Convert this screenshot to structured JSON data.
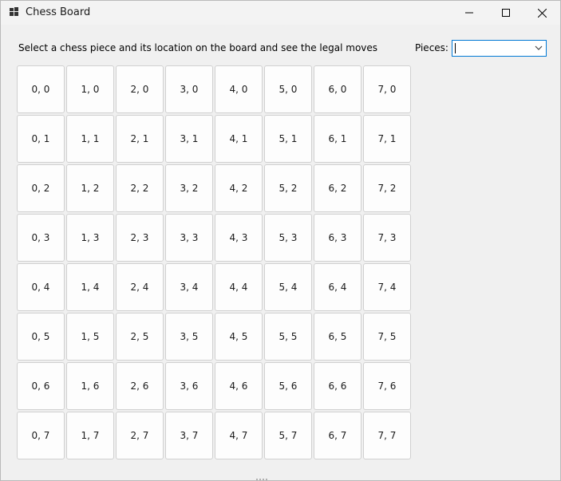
{
  "window": {
    "title": "Chess Board",
    "icon": "window-app-icon",
    "controls": {
      "minimize_icon": "minimize-icon",
      "maximize_icon": "maximize-icon",
      "close_icon": "close-icon"
    }
  },
  "main": {
    "prompt": "Select a chess piece and its location on the board and see the legal moves",
    "pieces_label": "Pieces:",
    "pieces_value": "",
    "pieces_dropdown_icon": "chevron-down-icon"
  },
  "board": {
    "rows": [
      [
        "0, 0",
        "1, 0",
        "2, 0",
        "3, 0",
        "4, 0",
        "5, 0",
        "6, 0",
        "7, 0"
      ],
      [
        "0, 1",
        "1, 1",
        "2, 1",
        "3, 1",
        "4, 1",
        "5, 1",
        "6, 1",
        "7, 1"
      ],
      [
        "0, 2",
        "1, 2",
        "2, 2",
        "3, 2",
        "4, 2",
        "5, 2",
        "6, 2",
        "7, 2"
      ],
      [
        "0, 3",
        "1, 3",
        "2, 3",
        "3, 3",
        "4, 3",
        "5, 3",
        "6, 3",
        "7, 3"
      ],
      [
        "0, 4",
        "1, 4",
        "2, 4",
        "3, 4",
        "4, 4",
        "5, 4",
        "6, 4",
        "7, 4"
      ],
      [
        "0, 5",
        "1, 5",
        "2, 5",
        "3, 5",
        "4, 5",
        "5, 5",
        "6, 5",
        "7, 5"
      ],
      [
        "0, 6",
        "1, 6",
        "2, 6",
        "3, 6",
        "4, 6",
        "5, 6",
        "6, 6",
        "7, 6"
      ],
      [
        "0, 7",
        "1, 7",
        "2, 7",
        "3, 7",
        "4, 7",
        "5, 7",
        "6, 7",
        "7, 7"
      ]
    ]
  },
  "colors": {
    "accent": "#0078d4",
    "background": "#f0f0f0",
    "cell": "#fdfdfd"
  }
}
